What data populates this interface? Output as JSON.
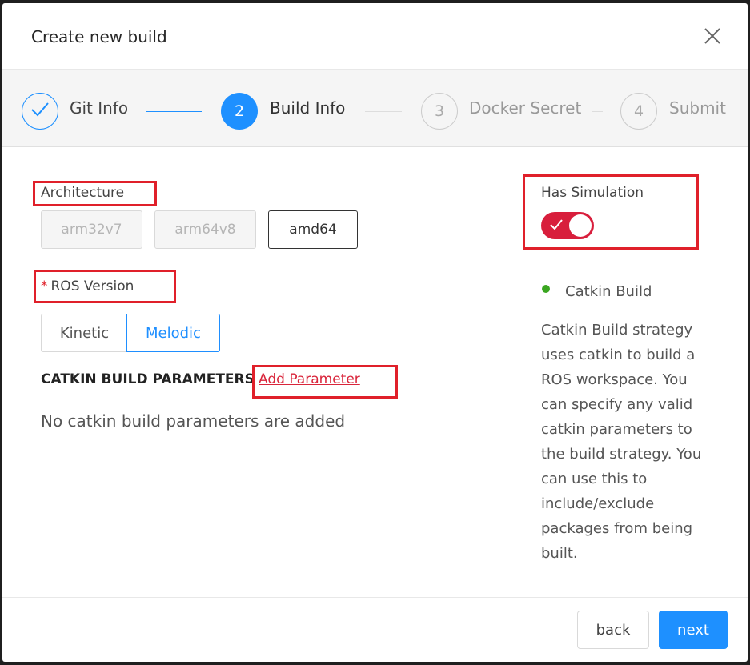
{
  "modal": {
    "title": "Create new build",
    "close_icon": "close-icon"
  },
  "steps": [
    {
      "number": "1",
      "label": "Git Info",
      "status": "completed",
      "icon": "checkmark-icon"
    },
    {
      "number": "2",
      "label": "Build Info",
      "status": "active"
    },
    {
      "number": "3",
      "label": "Docker Secret",
      "status": "pending"
    },
    {
      "number": "4",
      "label": "Submit",
      "status": "pending"
    }
  ],
  "architecture": {
    "label": "Architecture",
    "options": [
      {
        "label": "arm32v7",
        "state": "disabled"
      },
      {
        "label": "arm64v8",
        "state": "disabled"
      },
      {
        "label": "amd64",
        "state": "selected"
      }
    ]
  },
  "ros_version": {
    "required_mark": "*",
    "label": "ROS Version",
    "options": [
      {
        "label": "Kinetic",
        "selected": false
      },
      {
        "label": "Melodic",
        "selected": true
      }
    ]
  },
  "catkin": {
    "heading": "CATKIN BUILD PARAMETERS",
    "add_link": "Add Parameter",
    "empty_text": "No catkin build parameters are added"
  },
  "simulation": {
    "label": "Has Simulation",
    "enabled": true
  },
  "strategy": {
    "name": "Catkin Build",
    "description": "Catkin Build strategy uses catkin to build a ROS workspace. You can specify any valid catkin parameters to the build strategy. You can use this to include/exclude packages from being built."
  },
  "footer": {
    "back_label": "back",
    "next_label": "next"
  },
  "colors": {
    "primary": "#1e90ff",
    "highlight_box": "#e0202a",
    "toggle_on": "#d81e3c",
    "status_dot": "#3aa620"
  }
}
